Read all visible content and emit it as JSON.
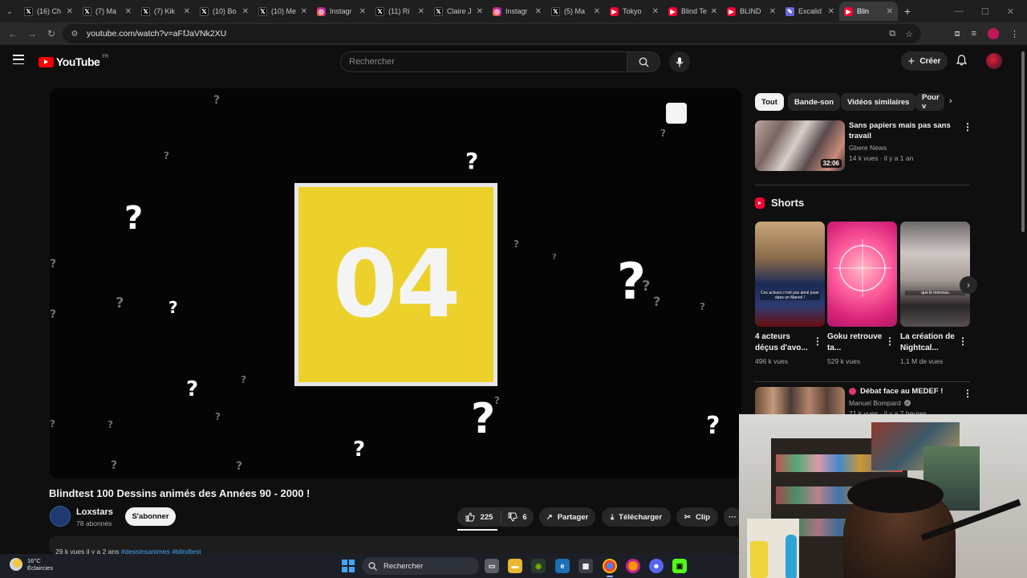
{
  "browser": {
    "tabs": [
      {
        "label": "(16) Ch",
        "icon": "x-icon",
        "kind": "x"
      },
      {
        "label": "(7) Ma",
        "icon": "x-icon",
        "kind": "x"
      },
      {
        "label": "(7) Kik",
        "icon": "x-icon",
        "kind": "x"
      },
      {
        "label": "(10) Bo",
        "icon": "x-icon",
        "kind": "x"
      },
      {
        "label": "(10) Me",
        "icon": "x-icon",
        "kind": "x"
      },
      {
        "label": "Instagr",
        "icon": "instagram-icon",
        "kind": "ig"
      },
      {
        "label": "(11) Ri",
        "icon": "x-icon",
        "kind": "x"
      },
      {
        "label": "Claire J",
        "icon": "x-icon",
        "kind": "x"
      },
      {
        "label": "Instagr",
        "icon": "instagram-icon",
        "kind": "ig"
      },
      {
        "label": "(5) Ma",
        "icon": "x-icon",
        "kind": "x"
      },
      {
        "label": "Tokyo",
        "icon": "youtube-icon",
        "kind": "yt"
      },
      {
        "label": "Blind Te",
        "icon": "youtube-icon",
        "kind": "yt"
      },
      {
        "label": "BLIND",
        "icon": "youtube-icon",
        "kind": "yt"
      },
      {
        "label": "Excalid",
        "icon": "excalidraw-icon",
        "kind": "ex"
      },
      {
        "label": "Blin",
        "icon": "youtube-icon",
        "kind": "yt",
        "active": true
      }
    ],
    "url": "youtube.com/watch?v=aFfJaVNk2XU"
  },
  "header": {
    "logo_text": "YouTube",
    "country_code": "FR",
    "search_placeholder": "Rechercher",
    "create_label": "Créer"
  },
  "player": {
    "card_number": "04",
    "question_mark": "?"
  },
  "video": {
    "title": "Blindtest 100 Dessins animés des Années 90 - 2000 !",
    "channel": "Loxstars",
    "subscribers": "78 abonnés",
    "subscribe_label": "S'abonner",
    "likes": "225",
    "dislikes": "6",
    "share_label": "Partager",
    "download_label": "Télécharger",
    "clip_label": "Clip",
    "more_label": "···",
    "stats": "29 k vues  il y a 2 ans",
    "hashtags": "#dessinsanimes #blindtest"
  },
  "sidebar": {
    "chips": [
      "Tout",
      "Bande-son",
      "Vidéos similaires",
      "Pour v"
    ],
    "recommended": {
      "title": "Sans papiers mais pas sans travail",
      "channel": "Gbere News",
      "meta": "14 k vues · il y a 1 an",
      "duration": "32:06"
    },
    "shorts_title": "Shorts",
    "shorts": [
      {
        "title": "4 acteurs déçus d'avo...",
        "views": "496 k vues",
        "caption": "Ces acteurs n'ont pas aimé jouer dans un Marvel !"
      },
      {
        "title": "Goku retrouve ta...",
        "views": "529 k vues",
        "caption": ""
      },
      {
        "title": "La création de Nightcal...",
        "views": "1,1 M de vues",
        "caption": "que le morceau"
      }
    ],
    "live": {
      "title": "Débat face au MEDEF !",
      "channel": "Manuel Bompard",
      "meta": "71 k vues · il y a 7 heures"
    }
  },
  "taskbar": {
    "temperature": "16°C",
    "weather": "Éclaircies",
    "search_label": "Rechercher"
  },
  "colors": {
    "background": "#0f0f0f",
    "yt_red": "#ff0000",
    "card_yellow": "#ecd12b",
    "link_blue": "#3ea6ff"
  }
}
